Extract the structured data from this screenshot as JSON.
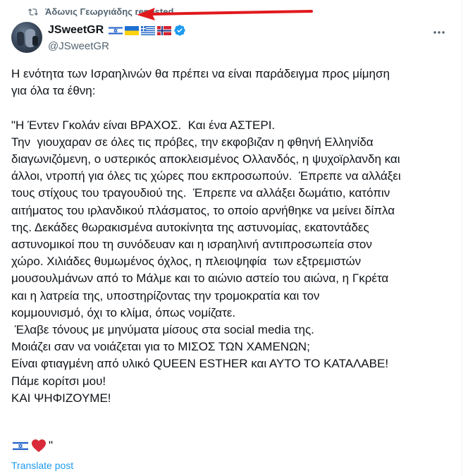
{
  "repost": {
    "text": "Άδωνις Γεωργιάδης reposted",
    "icon": "repost-icon"
  },
  "author": {
    "display_name": "JSweetGR",
    "handle": "@JSweetGR",
    "flags": [
      "israel-flag-icon",
      "ukraine-flag-icon",
      "greece-flag-icon",
      "norway-flag-icon"
    ],
    "verified": true
  },
  "post": {
    "body": "Η ενότητα των Ισραηλινών θα πρέπει να είναι παράδειγμα προς μίμηση\nγια όλα τα έθνη:\n\n\"Η Έντεν Γκολάν είναι ΒΡΑΧΟΣ.  Και ένα ΑΣΤΕΡΙ.\nΤην  γιουχαραν σε όλες τις πρόβες, την εκφοβιζαν η φθηνή Ελληνίδα\nδιαγωνιζόμενη, ο υστερικός αποκλεισμένος Ολλανδός, η ψυχοϊρλανδη και\nάλλοι, ντροπή για όλες τις χώρες που εκπροσωπούν.  Έπρεπε να αλλάξει\nτους στίχους του τραγουδιού της.  Έπρεπε να αλλάξει δωμάτιο, κατόπιν\nαιτήματος του ιρλανδικού πλάσματος, το οποίο αρνήθηκε να μείνει δίπλα\nτης. Δεκάδες θωρακισμένα αυτοκίνητα της αστυνομίας, εκατοντάδες\nαστυνομικοί που τη συνόδευαν και η ισραηλινή αντιπροσωπεία στον\nχώρο. Χιλιάδες θυμωμένος όχλος, η πλειοψηφία  των εξτρεμιστών\nμουσουλμάνων από το Μάλμε και το αιώνιο αστείο του αιώνα, η Γκρέτα\nκαι η λατρεία της, υποστηρίζοντας την τρομοκρατία και τον\nκομμουνισμό, όχι το κλίμα, όπως νομίζατε.\n Έλαβε τόνους με μηνύματα μίσους στα social media της.\nΜοιάζει σαν να νοιάζεται για το ΜΙΣΟΣ ΤΩΝ ΧΑΜΕΝΩΝ;\nΕίναι φτιαγμένη από υλικό QUEEN ESTHER και ΑΥΤΟ ΤΟ ΚΑΤΑΛΑΒΕ!\nΠάμε κορίτσι μου!\nΚΑΙ ΨΗΦΙΖΟΥΜΕ!",
    "trailing_emojis": [
      "israel-flag-icon",
      "red-heart-icon"
    ],
    "trailing_quote": "\"",
    "translate_label": "Translate post"
  },
  "colors": {
    "text": "#0f1419",
    "secondary": "#536471",
    "link": "#1d9bf0",
    "verified": "#1d9bf0",
    "annotation_arrow": "#e0191d"
  },
  "icons": {
    "more": "more-horizontal-icon",
    "annotation": "red-arrow-annotation"
  }
}
